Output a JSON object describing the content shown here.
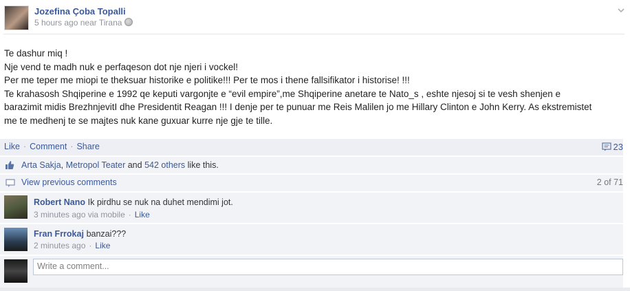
{
  "post": {
    "author": "Jozefina Çoba Topalli",
    "meta_time": "5 hours ago near Tirana",
    "body": [
      "Te dashur miq !",
      "Nje vend te madh nuk e perfaqeson dot nje njeri i vockel!",
      "Per me teper me miopi te theksuar historike e politike!!! Per te mos i thene fallsifikator i historise! !!!",
      "Te krahasosh Shqiperine e 1992 qe keputi vargonjte e “evil empire”,me Shqiperine anetare te Nato_s , eshte njesoj si te vesh shenjen e",
      "barazimit midis BrezhnjevitI dhe Presidentit Reagan !!! I denje per te punuar me Reis Malilen jo me Hillary Clinton e John Kerry. As ekstremistet",
      "me te medhenj te se majtes nuk kane guxuar kurre nje gje te tille."
    ]
  },
  "actions": {
    "like": "Like",
    "comment": "Comment",
    "share": "Share",
    "comment_count": "23"
  },
  "likes": {
    "name1": "Arta Sakja",
    "name2": "Metropol Teater",
    "and": "and",
    "others": "542 others",
    "suffix": "like this."
  },
  "previous": {
    "label": "View previous comments",
    "paging": "2 of 71"
  },
  "comments": [
    {
      "name": "Robert Nano",
      "text": "Ik pirdhu se nuk na duhet mendimi jot.",
      "time": "3 minutes ago via mobile",
      "like": "Like"
    },
    {
      "name": "Fran Frrokaj",
      "text": "banzai???",
      "time": "2 minutes ago",
      "like": "Like"
    }
  ],
  "composer": {
    "placeholder": "Write a comment..."
  },
  "colors": {
    "link": "#3b5998",
    "panel": "#edeff4",
    "meta": "#90949c"
  }
}
